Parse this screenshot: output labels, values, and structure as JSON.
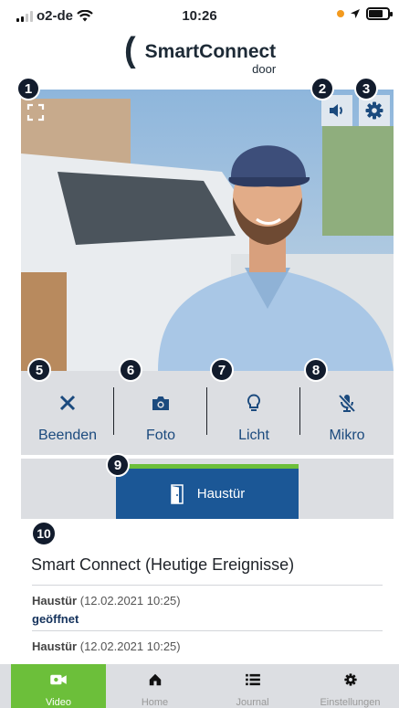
{
  "status_bar": {
    "carrier": "o2-de",
    "time": "10:26",
    "signal_bars": 2,
    "battery_level": 0.75
  },
  "logo": {
    "paren": "(",
    "name": "SmartConnect",
    "sub": "door"
  },
  "callouts": [
    "1",
    "2",
    "3",
    "5",
    "6",
    "7",
    "8",
    "9",
    "10"
  ],
  "video": {
    "fullscreen_icon": "fullscreen-icon",
    "speaker_icon": "speaker-icon",
    "settings_icon": "gear-icon"
  },
  "actions": [
    {
      "label": "Beenden",
      "icon": "close-icon"
    },
    {
      "label": "Foto",
      "icon": "camera-icon"
    },
    {
      "label": "Licht",
      "icon": "lightbulb-icon"
    },
    {
      "label": "Mikro",
      "icon": "mic-muted-icon"
    }
  ],
  "door_button": {
    "label": "Haustür",
    "icon": "door-icon"
  },
  "events": {
    "title": "Smart Connect (Heutige Ereignisse)",
    "items": [
      {
        "source": "Haustür",
        "timestamp": "(12.02.2021 10:25)",
        "status": "geöffnet"
      },
      {
        "source": "Haustür",
        "timestamp": "(12.02.2021 10:25)",
        "status": ""
      }
    ]
  },
  "tabs": [
    {
      "label": "Video",
      "icon": "video-icon",
      "active": true
    },
    {
      "label": "Home",
      "icon": "home-icon",
      "active": false
    },
    {
      "label": "Journal",
      "icon": "list-icon",
      "active": false
    },
    {
      "label": "Einstellungen",
      "icon": "gear-icon",
      "active": false
    }
  ],
  "colors": {
    "accent_green": "#6cbf3a",
    "primary_blue": "#1b5796",
    "label_blue": "#1b4a7e",
    "panel_grey": "#dcdee2",
    "callout_navy": "#121c2d"
  }
}
